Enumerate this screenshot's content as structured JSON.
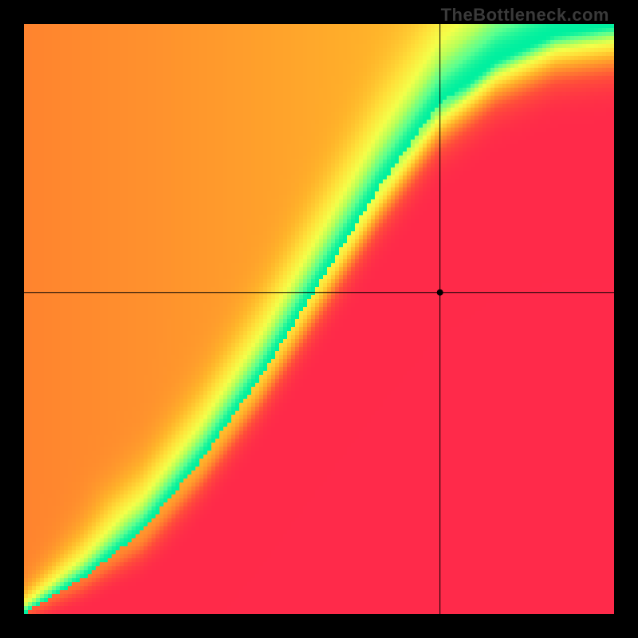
{
  "watermark": "TheBottleneck.com",
  "chart_data": {
    "type": "heatmap",
    "title": "",
    "xlabel": "",
    "ylabel": "",
    "xlim": [
      0,
      1
    ],
    "ylim": [
      0,
      1
    ],
    "crosshair": {
      "x": 0.705,
      "y": 0.545
    },
    "legend_position": "none",
    "color_stops": [
      {
        "t": 0.0,
        "color": "#ff2a4a"
      },
      {
        "t": 0.2,
        "color": "#ff4f3a"
      },
      {
        "t": 0.4,
        "color": "#ff8a2e"
      },
      {
        "t": 0.55,
        "color": "#ffb42a"
      },
      {
        "t": 0.7,
        "color": "#ffe13a"
      },
      {
        "t": 0.82,
        "color": "#f4ff4a"
      },
      {
        "t": 0.9,
        "color": "#b8ff5a"
      },
      {
        "t": 0.965,
        "color": "#5cff90"
      },
      {
        "t": 1.0,
        "color": "#00f0a0"
      }
    ],
    "ridge": {
      "description": "Green optimal band running diagonally; value peaks where y ≈ f(x) along an S-shaped curve.",
      "control_points": [
        {
          "x": 0.0,
          "y": 0.0
        },
        {
          "x": 0.1,
          "y": 0.06
        },
        {
          "x": 0.2,
          "y": 0.14
        },
        {
          "x": 0.3,
          "y": 0.26
        },
        {
          "x": 0.4,
          "y": 0.4
        },
        {
          "x": 0.5,
          "y": 0.56
        },
        {
          "x": 0.6,
          "y": 0.72
        },
        {
          "x": 0.7,
          "y": 0.86
        },
        {
          "x": 0.8,
          "y": 0.94
        },
        {
          "x": 0.9,
          "y": 0.985
        },
        {
          "x": 1.0,
          "y": 1.0
        }
      ],
      "sigma_below": 0.03,
      "sigma_above": 0.055,
      "sigma_grow_below": 0.02,
      "sigma_grow_above": 0.06,
      "floor_below_factor": 0.0,
      "floor_above_base": 0.38,
      "floor_above_grow": 0.25
    },
    "resolution": 148
  }
}
